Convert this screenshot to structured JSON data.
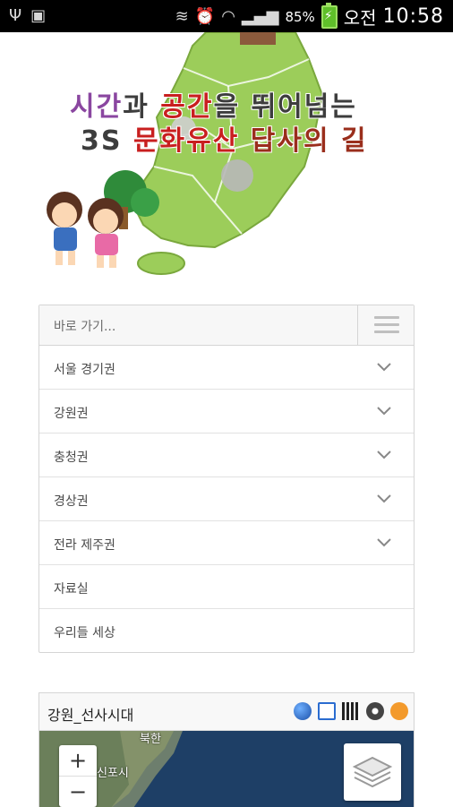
{
  "status_bar": {
    "battery_percent": "85%",
    "ampm": "오전",
    "time": "10:58",
    "icons": [
      "usb-icon",
      "screenshot-icon",
      "vibrate-icon",
      "alarm-icon",
      "wifi-icon",
      "signal-icon",
      "battery-icon"
    ]
  },
  "banner": {
    "line1_parts": [
      "시간",
      "과 ",
      "공간",
      "을 뛰어넘는"
    ],
    "line2_parts": [
      "3S ",
      "문화유산",
      " 답사의 길"
    ],
    "colors": {
      "purple": "#8a46a0",
      "red": "#c81f1f",
      "brown": "#9a2e1c",
      "map_green": "#9ccd5a"
    }
  },
  "menu": {
    "header_label": "바로 가기...",
    "items": [
      {
        "label": "서울 경기권",
        "has_submenu": true
      },
      {
        "label": "강원권",
        "has_submenu": true
      },
      {
        "label": "충청권",
        "has_submenu": true
      },
      {
        "label": "경상권",
        "has_submenu": true
      },
      {
        "label": "전라 제주권",
        "has_submenu": true
      },
      {
        "label": "자료실",
        "has_submenu": false
      },
      {
        "label": "우리들 세상",
        "has_submenu": false
      }
    ]
  },
  "map_widget": {
    "title": "강원_선사시대",
    "zoom_in": "+",
    "zoom_out": "−",
    "place_labels": [
      "신포시",
      "북한"
    ],
    "tools": [
      "google-earth-icon",
      "fullscreen-icon",
      "qr-code-icon",
      "kml-icon",
      "rss-icon"
    ]
  }
}
